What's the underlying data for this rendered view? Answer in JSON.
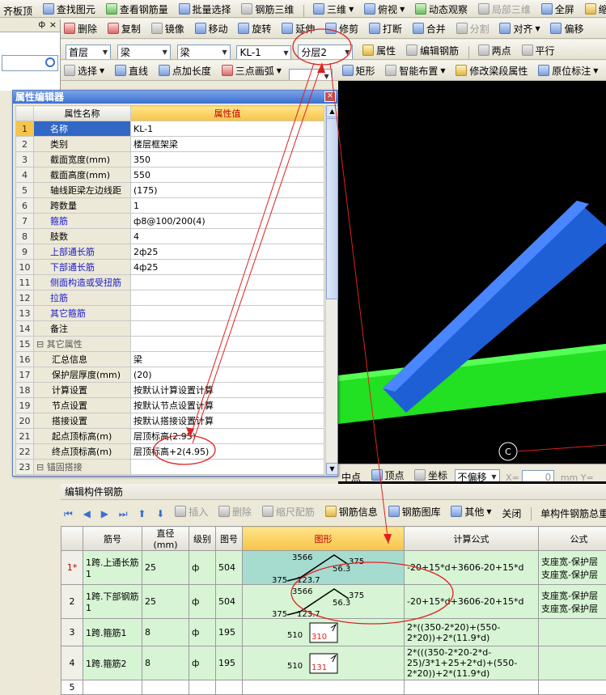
{
  "toolbar1": {
    "items": [
      "齐板顶",
      "查找图元",
      "查看钢筋量",
      "批量选择",
      "钢筋三维",
      "三维",
      "俯视",
      "动态观察",
      "局部三维",
      "全屏",
      "缩"
    ]
  },
  "toolbar2": {
    "items": [
      "删除",
      "复制",
      "镜像",
      "移动",
      "旋转",
      "延伸",
      "修剪",
      "打断",
      "合并",
      "分割",
      "对齐",
      "偏移"
    ]
  },
  "toolbar3": {
    "floor": "首层",
    "category": "梁",
    "type": "梁",
    "component": "KL-1",
    "layer": "分层2",
    "property_label": "属性",
    "edit_rebar_label": "编辑钢筋",
    "two_points_label": "两点",
    "parallel_label": "平行"
  },
  "toolbar4": {
    "select_label": "选择",
    "line_label": "直线",
    "point_len_label": "点加长度",
    "arc_label": "三点画弧",
    "rect_label": "矩形",
    "smart_label": "智能布置",
    "modify_seg_label": "修改梁段属性",
    "origin_label": "原位标注"
  },
  "left_panel": {
    "pin": "ф",
    "close": "×",
    "search_icon": "search"
  },
  "prop_editor": {
    "title": "属性编辑器",
    "col_name": "属性名称",
    "col_value": "属性值",
    "rows": [
      {
        "n": "1",
        "name": "名称",
        "value": "KL-1"
      },
      {
        "n": "2",
        "name": "类别",
        "value": "楼层框架梁"
      },
      {
        "n": "3",
        "name": "截面宽度(mm)",
        "value": "350"
      },
      {
        "n": "4",
        "name": "截面高度(mm)",
        "value": "550"
      },
      {
        "n": "5",
        "name": "轴线距梁左边线距",
        "value": "(175)"
      },
      {
        "n": "6",
        "name": "跨数量",
        "value": "1"
      },
      {
        "n": "7",
        "name": "箍筋",
        "value": "ф8@100/200(4)"
      },
      {
        "n": "8",
        "name": "肢数",
        "value": "4"
      },
      {
        "n": "9",
        "name": "上部通长筋",
        "value": "2ф25"
      },
      {
        "n": "10",
        "name": "下部通长筋",
        "value": "4ф25"
      },
      {
        "n": "11",
        "name": "侧面构造或受扭筋",
        "value": ""
      },
      {
        "n": "12",
        "name": "拉筋",
        "value": ""
      },
      {
        "n": "13",
        "name": "其它箍筋",
        "value": ""
      },
      {
        "n": "14",
        "name": "备注",
        "value": ""
      },
      {
        "n": "15",
        "name": "其它属性",
        "value": ""
      },
      {
        "n": "16",
        "name": "汇总信息",
        "value": "梁"
      },
      {
        "n": "17",
        "name": "保护层厚度(mm)",
        "value": "(20)"
      },
      {
        "n": "18",
        "name": "计算设置",
        "value": "按默认计算设置计算"
      },
      {
        "n": "19",
        "name": "节点设置",
        "value": "按默认节点设置计算"
      },
      {
        "n": "20",
        "name": "搭接设置",
        "value": "按默认搭接设置计算"
      },
      {
        "n": "21",
        "name": "起点顶标高(m)",
        "value": "层顶标高(2.95)"
      },
      {
        "n": "22",
        "name": "终点顶标高(m)",
        "value": "层顶标高+2(4.95)"
      },
      {
        "n": "23",
        "name": "锚固搭接",
        "value": ""
      }
    ]
  },
  "canvas_bar": {
    "midpoint": "中点",
    "vertex": "顶点",
    "coord": "坐标",
    "offset": "不偏移",
    "x_label": "X=",
    "x_val": "0",
    "unit": "mm",
    "y_label": "Y=",
    "axis_c": "C"
  },
  "edit_panel": {
    "title": "编辑构件钢筋",
    "buttons": [
      "插入",
      "删除",
      "缩尺配筋",
      "钢筋信息",
      "钢筋图库",
      "其他",
      "关闭",
      "单构件钢筋总重(kg)"
    ]
  },
  "rebar_table": {
    "headers": [
      "筋号",
      "直径(mm)",
      "级别",
      "图号",
      "图形",
      "计算公式",
      "公式"
    ],
    "rows": [
      {
        "n": "1*",
        "name": "1跨.上通长筋1",
        "dia": "25",
        "grade": "ф",
        "fig_no": "504",
        "shape": {
          "a": "3566",
          "b": "375",
          "c": "56.3",
          "d": "375",
          "e": "123.7"
        },
        "formula": "-20+15*d+3606-20+15*d",
        "desc": "支座宽-保护层\n支座宽-保护层"
      },
      {
        "n": "2",
        "name": "1跨.下部钢筋1",
        "dia": "25",
        "grade": "ф",
        "fig_no": "504",
        "shape": {
          "a": "3566",
          "b": "375",
          "c": "56.3",
          "d": "375",
          "e": "123.7"
        },
        "formula": "-20+15*d+3606-20+15*d",
        "desc": "支座宽-保护层\n支座宽-保护层"
      },
      {
        "n": "3",
        "name": "1跨.箍筋1",
        "dia": "8",
        "grade": "ф",
        "fig_no": "195",
        "shape": {
          "a": "510",
          "b": "310"
        },
        "formula": "2*((350-2*20)+(550-2*20))+2*(11.9*d)",
        "desc": ""
      },
      {
        "n": "4",
        "name": "1跨.箍筋2",
        "dia": "8",
        "grade": "ф",
        "fig_no": "195",
        "shape": {
          "a": "510",
          "b": "131"
        },
        "formula": "2*(((350-2*20-2*d-25)/3*1+25+2*d)+(550-2*20))+2*(11.9*d)",
        "desc": ""
      },
      {
        "n": "5",
        "name": "",
        "dia": "",
        "grade": "",
        "fig_no": "",
        "shape": {},
        "formula": "",
        "desc": ""
      }
    ]
  },
  "colors": {
    "accent": "#3168c6",
    "highlight": "#f6c448",
    "beam_blue": "#1f5fd6",
    "beam_green": "#22e022",
    "annot": "#e02020"
  }
}
